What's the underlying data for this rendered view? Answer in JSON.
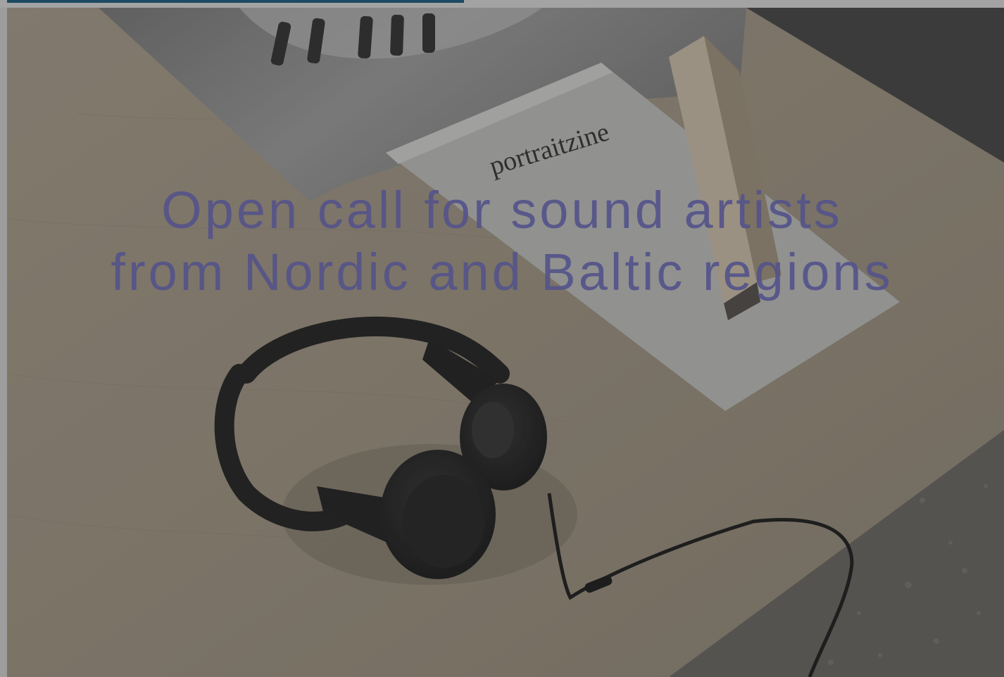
{
  "hero": {
    "headline_line1": "Open call for sound artists",
    "headline_line2": "from Nordic and Baltic regions",
    "zine_title": "portraitzine",
    "image_subject": "headphones-on-plywood-table-photo"
  },
  "progress": {
    "fraction": 0.458
  },
  "colors": {
    "headline": "#55548a",
    "progress_fill": "#1d4a63",
    "overlay": "#3a3a3a"
  }
}
